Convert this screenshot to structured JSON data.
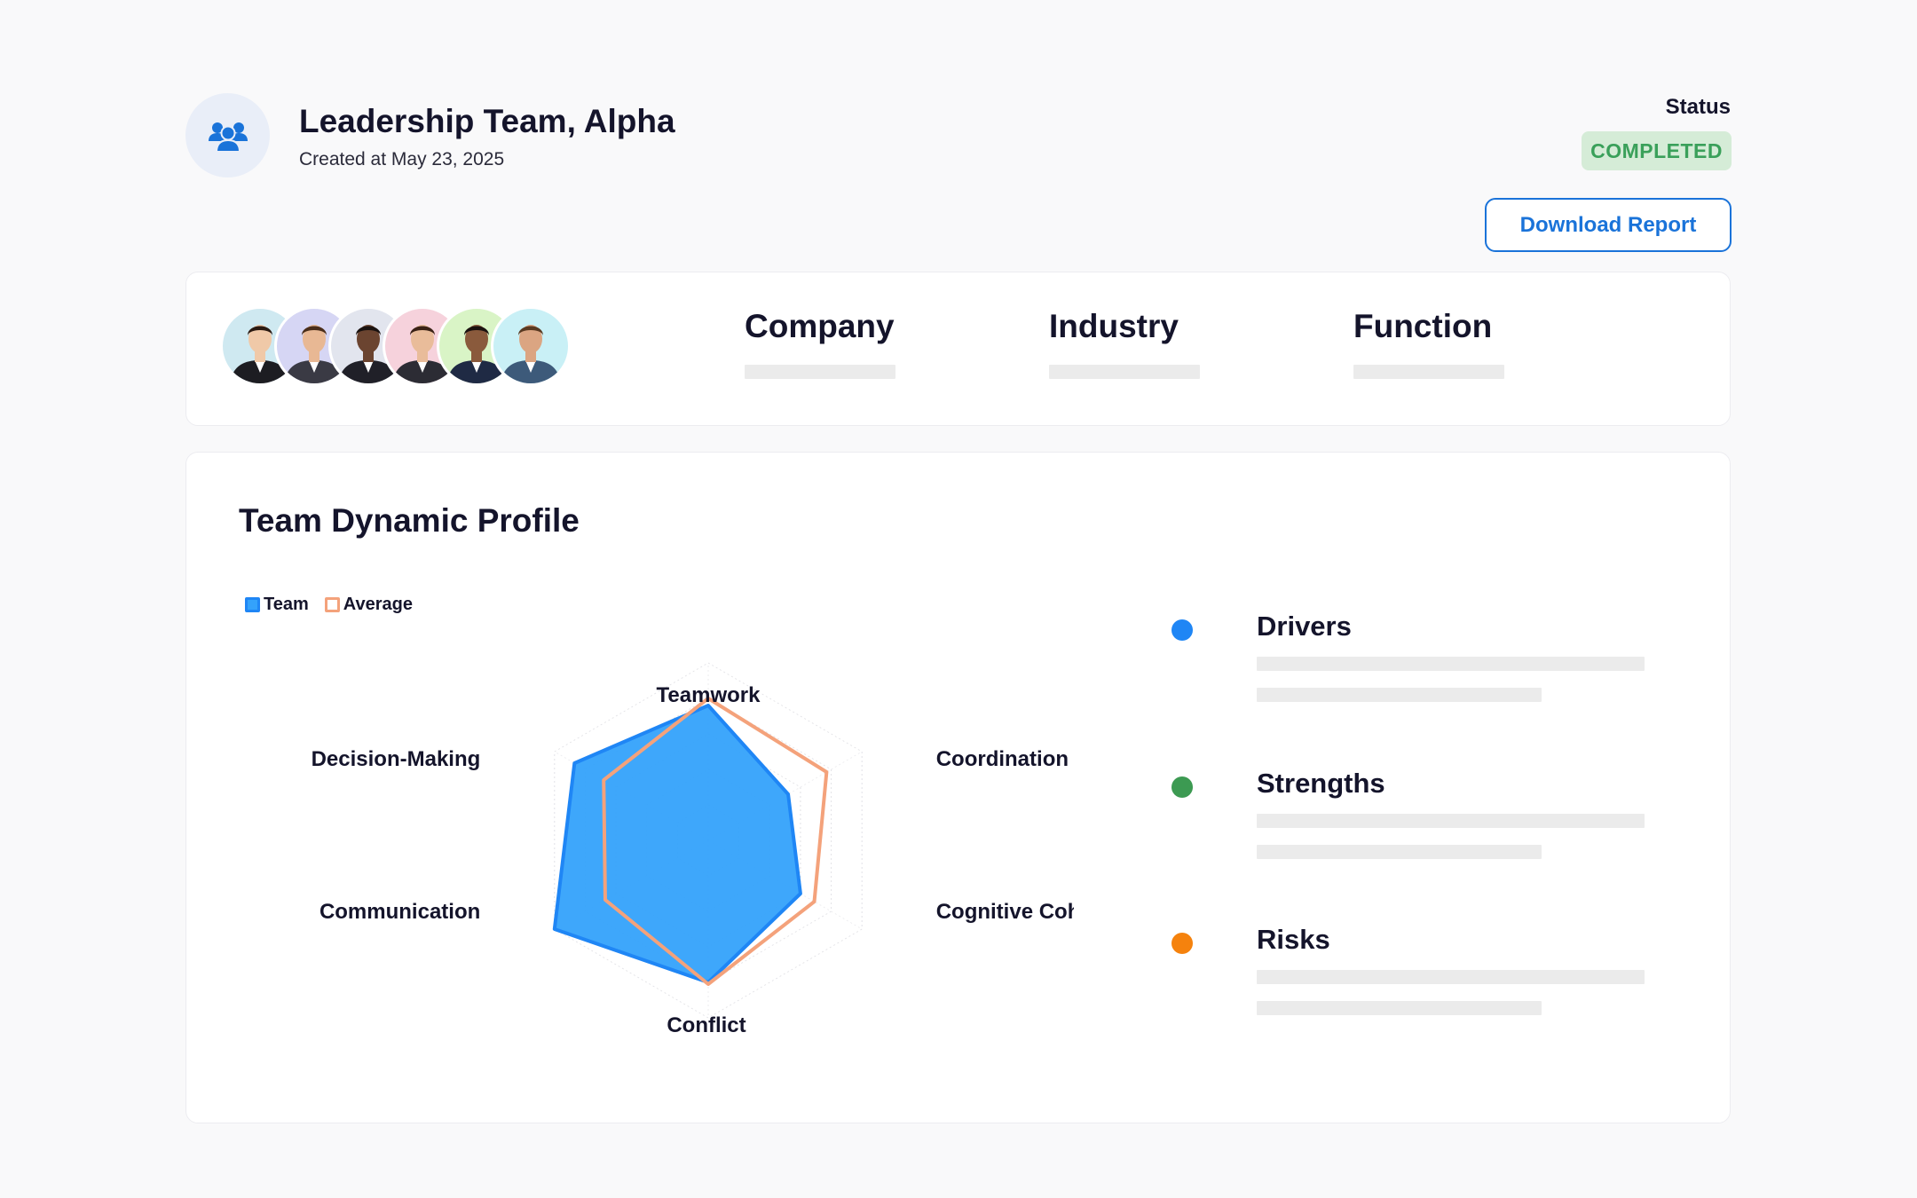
{
  "header": {
    "title": "Leadership Team, Alpha",
    "created": "Created at May 23, 2025",
    "status_label": "Status",
    "status_value": "COMPLETED",
    "download_label": "Download Report",
    "icon": "team-icon"
  },
  "info": {
    "columns": [
      {
        "title": "Company"
      },
      {
        "title": "Industry"
      },
      {
        "title": "Function"
      }
    ],
    "avatars": [
      {
        "bg": "#cfe9f1",
        "skin": "#f0c9a8",
        "hair": "#2a1a12",
        "suit": "#1d1d22"
      },
      {
        "bg": "#d6d6f4",
        "skin": "#e8b894",
        "hair": "#4a2e1a",
        "suit": "#3a3a44"
      },
      {
        "bg": "#e2e5ee",
        "skin": "#6b4430",
        "hair": "#1a1210",
        "suit": "#202028"
      },
      {
        "bg": "#f6d2dc",
        "skin": "#e9bc9a",
        "hair": "#3a2216",
        "suit": "#2c2c34"
      },
      {
        "bg": "#d9f4c6",
        "skin": "#8a5a3c",
        "hair": "#1a1210",
        "suit": "#1f2a44"
      },
      {
        "bg": "#c9f0f6",
        "skin": "#dba582",
        "hair": "#5a3a22",
        "suit": "#3d5a7a"
      }
    ]
  },
  "profile": {
    "title": "Team Dynamic Profile"
  },
  "insights": [
    {
      "title": "Drivers",
      "color": "#1f86f5"
    },
    {
      "title": "Strengths",
      "color": "#3c9a52"
    },
    {
      "title": "Risks",
      "color": "#f5820d"
    }
  ],
  "chart_data": {
    "type": "radar",
    "axes": [
      "Teamwork",
      "Coordination",
      "Cognitive Cohesion",
      "Conflict",
      "Communication",
      "Decision-Making"
    ],
    "max": 100,
    "gridLevels": 5,
    "series": [
      {
        "name": "Team",
        "values": [
          76,
          52,
          60,
          80,
          100,
          87
        ],
        "color": "#1f86f5",
        "fill": "#34a2fb"
      },
      {
        "name": "Average",
        "values": [
          80,
          77,
          69,
          81,
          67,
          68
        ],
        "color": "#f4a27b"
      }
    ]
  }
}
